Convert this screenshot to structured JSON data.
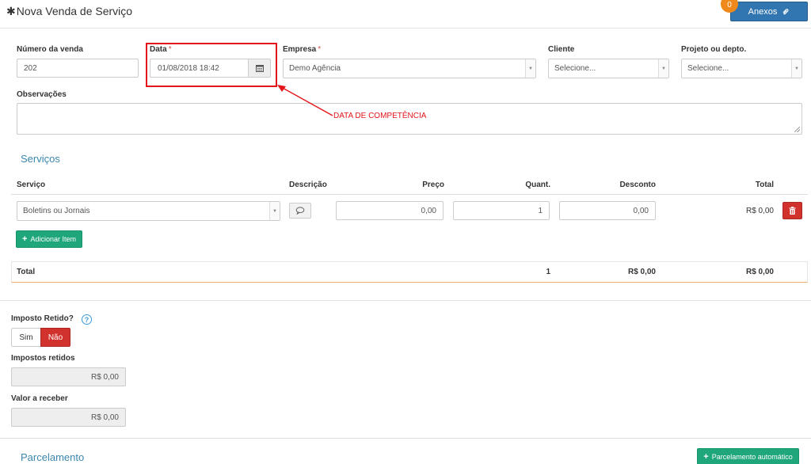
{
  "header": {
    "title": "Nova Venda de Serviço",
    "attachments_label": "Anexos",
    "attachments_count": "0"
  },
  "form": {
    "sale_number": {
      "label": "Número da venda",
      "value": "202"
    },
    "date": {
      "label": "Data",
      "required_mark": "*",
      "value": "01/08/2018 18:42"
    },
    "company": {
      "label": "Empresa",
      "required_mark": "*",
      "value": "Demo Agência"
    },
    "client": {
      "label": "Cliente",
      "value": "Selecione..."
    },
    "project": {
      "label": "Projeto ou depto.",
      "value": "Selecione..."
    },
    "notes": {
      "label": "Observações",
      "value": ""
    }
  },
  "annotation": {
    "text": "DATA DE COMPETÊNCIA",
    "color": "#e3151a"
  },
  "services": {
    "title": "Serviços",
    "columns": {
      "service": "Serviço",
      "description": "Descrição",
      "price": "Preço",
      "quantity": "Quant.",
      "discount": "Desconto",
      "total": "Total"
    },
    "rows": [
      {
        "service": "Boletins ou Jornais",
        "price": "0,00",
        "quantity": "1",
        "discount": "0,00",
        "total": "R$ 0,00"
      }
    ],
    "add_item_label": "Adicionar Item",
    "totals": {
      "label": "Total",
      "quantity": "1",
      "discount": "R$ 0,00",
      "total": "R$ 0,00"
    }
  },
  "taxes": {
    "withheld_question": "Imposto Retido?",
    "help": "?",
    "yes_label": "Sim",
    "no_label": "Não",
    "selected": "Não",
    "withheld_taxes": {
      "label": "Impostos retidos",
      "value": "R$ 0,00"
    },
    "receivable": {
      "label": "Valor a receber",
      "value": "R$ 0,00"
    }
  },
  "installments": {
    "title": "Parcelamento",
    "auto_button_label": "Parcelamento automático"
  },
  "colors": {
    "primary": "#3276b1",
    "danger": "#d2322d",
    "success": "#1fa67a",
    "badge": "#f0891b",
    "section_title": "#3a87ad"
  }
}
